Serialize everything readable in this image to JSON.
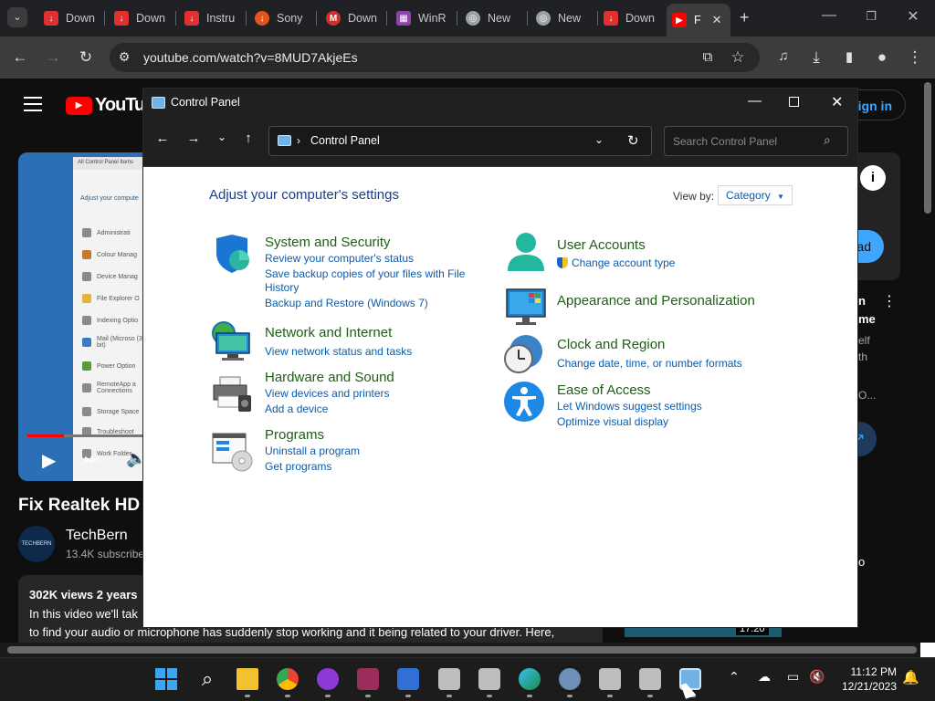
{
  "browser": {
    "tabs": [
      {
        "label": "Down",
        "color": "#e03030"
      },
      {
        "label": "Down",
        "color": "#e03030"
      },
      {
        "label": "Instru",
        "color": "#e03030"
      },
      {
        "label": "Sony",
        "color": "#e5541a"
      },
      {
        "label": "Down",
        "color": "#d32f2f"
      },
      {
        "label": "WinR",
        "color": "#8e44ad"
      },
      {
        "label": "New",
        "color": "#9aa0a6"
      },
      {
        "label": "New",
        "color": "#9aa0a6"
      },
      {
        "label": "Down",
        "color": "#e03030"
      },
      {
        "label": "F",
        "color": "#ff0000"
      }
    ],
    "url": "youtube.com/watch?v=8MUD7AkjeEs"
  },
  "youtube": {
    "logo_text": "YouTube",
    "sign_in": "Sign in",
    "video_title": "Fix Realtek HD",
    "channel_name": "TechBern",
    "channel_avatar_text": "TECHBERN",
    "subscribers": "13.4K subscribe",
    "views": "302K views  2 years",
    "desc_line1": "In this video we'll tak",
    "desc_line2": "to find your audio or microphone has suddenly stop working and it being related to your driver. Here,",
    "side_button": "ad",
    "side_n": "n",
    "side_me": "me",
    "side_elf": "elf",
    "side_th": "th",
    "side_o": "O...",
    "side_o2": "o",
    "preview_time": "17:20",
    "thumb_items": [
      "All Control Panel Items",
      "Adjust your compute",
      "Administrati",
      "Colour Manag",
      "Device Manag",
      "File Explorer O",
      "Indexing Optio",
      "Mail (Microso (32-bit)",
      "Power Option",
      "RemoteApp a Connections",
      "Storage Space",
      "Troubleshoot",
      "Work Folder"
    ]
  },
  "control_panel": {
    "title": "Control Panel",
    "breadcrumb": "Control Panel",
    "search_placeholder": "Search Control Panel",
    "heading": "Adjust your computer's settings",
    "view_by_label": "View by:",
    "view_by_value": "Category",
    "categories": {
      "system": {
        "title": "System and Security",
        "links": [
          "Review your computer's status",
          "Save backup copies of your files with File History",
          "Backup and Restore (Windows 7)"
        ]
      },
      "network": {
        "title": "Network and Internet",
        "links": [
          "View network status and tasks"
        ]
      },
      "hardware": {
        "title": "Hardware and Sound",
        "links": [
          "View devices and printers",
          "Add a device"
        ]
      },
      "programs": {
        "title": "Programs",
        "links": [
          "Uninstall a program",
          "Get programs"
        ]
      },
      "users": {
        "title": "User Accounts",
        "links": [
          "Change account type"
        ]
      },
      "appearance": {
        "title": "Appearance and Personalization"
      },
      "clock": {
        "title": "Clock and Region",
        "links": [
          "Change date, time, or number formats"
        ]
      },
      "ease": {
        "title": "Ease of Access",
        "links": [
          "Let Windows suggest settings",
          "Optimize visual display"
        ]
      }
    }
  },
  "taskbar": {
    "time": "11:12 PM",
    "date": "12/21/2023"
  }
}
